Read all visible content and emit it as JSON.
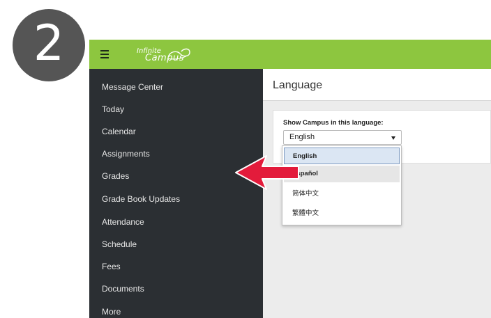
{
  "step": {
    "number": "2"
  },
  "header": {
    "logo_line1": "Infinite",
    "logo_line2": "Campus",
    "brand_color": "#8dc63f"
  },
  "sidebar": {
    "items": [
      {
        "label": "Message Center"
      },
      {
        "label": "Today"
      },
      {
        "label": "Calendar"
      },
      {
        "label": "Assignments"
      },
      {
        "label": "Grades"
      },
      {
        "label": "Grade Book Updates"
      },
      {
        "label": "Attendance"
      },
      {
        "label": "Schedule"
      },
      {
        "label": "Fees"
      },
      {
        "label": "Documents"
      },
      {
        "label": "More"
      }
    ],
    "background_color": "#2b2f33"
  },
  "main": {
    "title": "Language",
    "field_label": "Show Campus in this language:",
    "select_value": "English",
    "options": [
      {
        "label": "English",
        "state": "selected"
      },
      {
        "label": "Español",
        "state": "hover"
      },
      {
        "label": "简体中文",
        "state": "normal"
      },
      {
        "label": "繁體中文",
        "state": "normal"
      }
    ]
  },
  "annotation": {
    "arrow_color": "#e31b3b",
    "points_to": "Español"
  }
}
